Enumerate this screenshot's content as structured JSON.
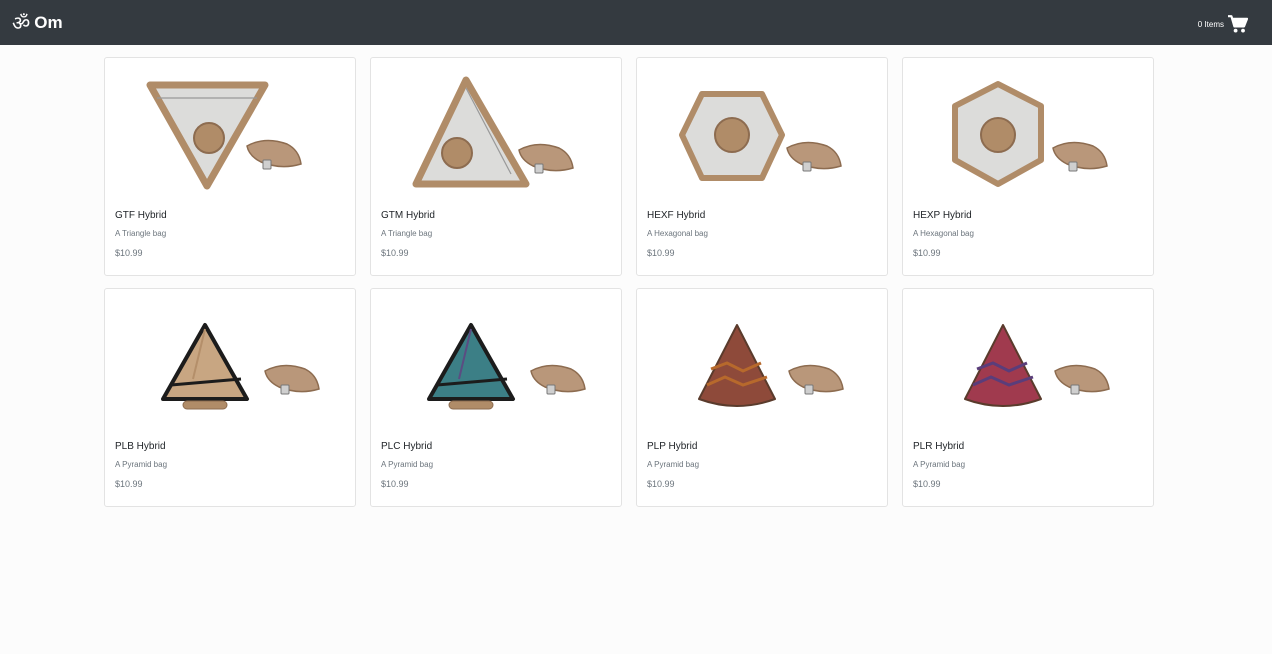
{
  "brand": {
    "symbol": "ॐ",
    "name": "Om"
  },
  "cart": {
    "count_label": "0 Items",
    "icon": "shopping-cart-icon"
  },
  "colors": {
    "navbar": "#343a40",
    "price": "#6c757d"
  },
  "products": [
    {
      "name": "GTF Hybrid",
      "description": "A Triangle bag",
      "price": "$10.99",
      "shape": "triangle-down",
      "fabric": "silver"
    },
    {
      "name": "GTM Hybrid",
      "description": "A Triangle bag",
      "price": "$10.99",
      "shape": "triangle-up",
      "fabric": "silver"
    },
    {
      "name": "HEXF Hybrid",
      "description": "A Hexagonal bag",
      "price": "$10.99",
      "shape": "hexagon-flat",
      "fabric": "silver"
    },
    {
      "name": "HEXP Hybrid",
      "description": "A Hexagonal bag",
      "price": "$10.99",
      "shape": "hexagon-point",
      "fabric": "silver"
    },
    {
      "name": "PLB Hybrid",
      "description": "A Pyramid bag",
      "price": "$10.99",
      "shape": "pyramid-open",
      "fabric": "tan"
    },
    {
      "name": "PLC Hybrid",
      "description": "A Pyramid bag",
      "price": "$10.99",
      "shape": "pyramid-open",
      "fabric": "teal"
    },
    {
      "name": "PLP Hybrid",
      "description": "A Pyramid bag",
      "price": "$10.99",
      "shape": "pyramid",
      "fabric": "purple-orange"
    },
    {
      "name": "PLR Hybrid",
      "description": "A Pyramid bag",
      "price": "$10.99",
      "shape": "pyramid",
      "fabric": "red-purple"
    }
  ]
}
